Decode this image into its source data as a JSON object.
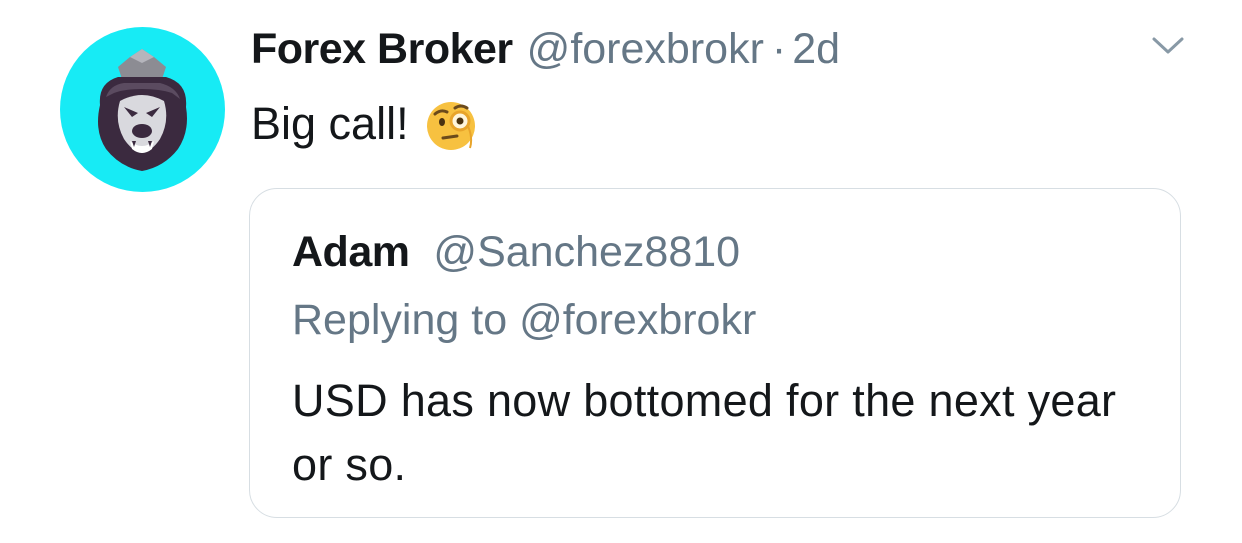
{
  "tweet": {
    "display_name": "Forex Broker",
    "handle": "@forexbrokr",
    "separator": "·",
    "time": "2d",
    "text": "Big call!",
    "emoji": "face-with-monocle"
  },
  "quote": {
    "display_name": "Adam",
    "handle": "@Sanchez8810",
    "replying_to": "Replying to @forexbrokr",
    "text": "USD has now bottomed for the next year or so."
  },
  "colors": {
    "avatar_bg": "#17ebf5",
    "primary_text": "#14171a",
    "secondary_text": "#657786",
    "border": "#d7dee3"
  },
  "icons": {
    "avatar": "lion-logo",
    "menu": "chevron-down-icon"
  }
}
